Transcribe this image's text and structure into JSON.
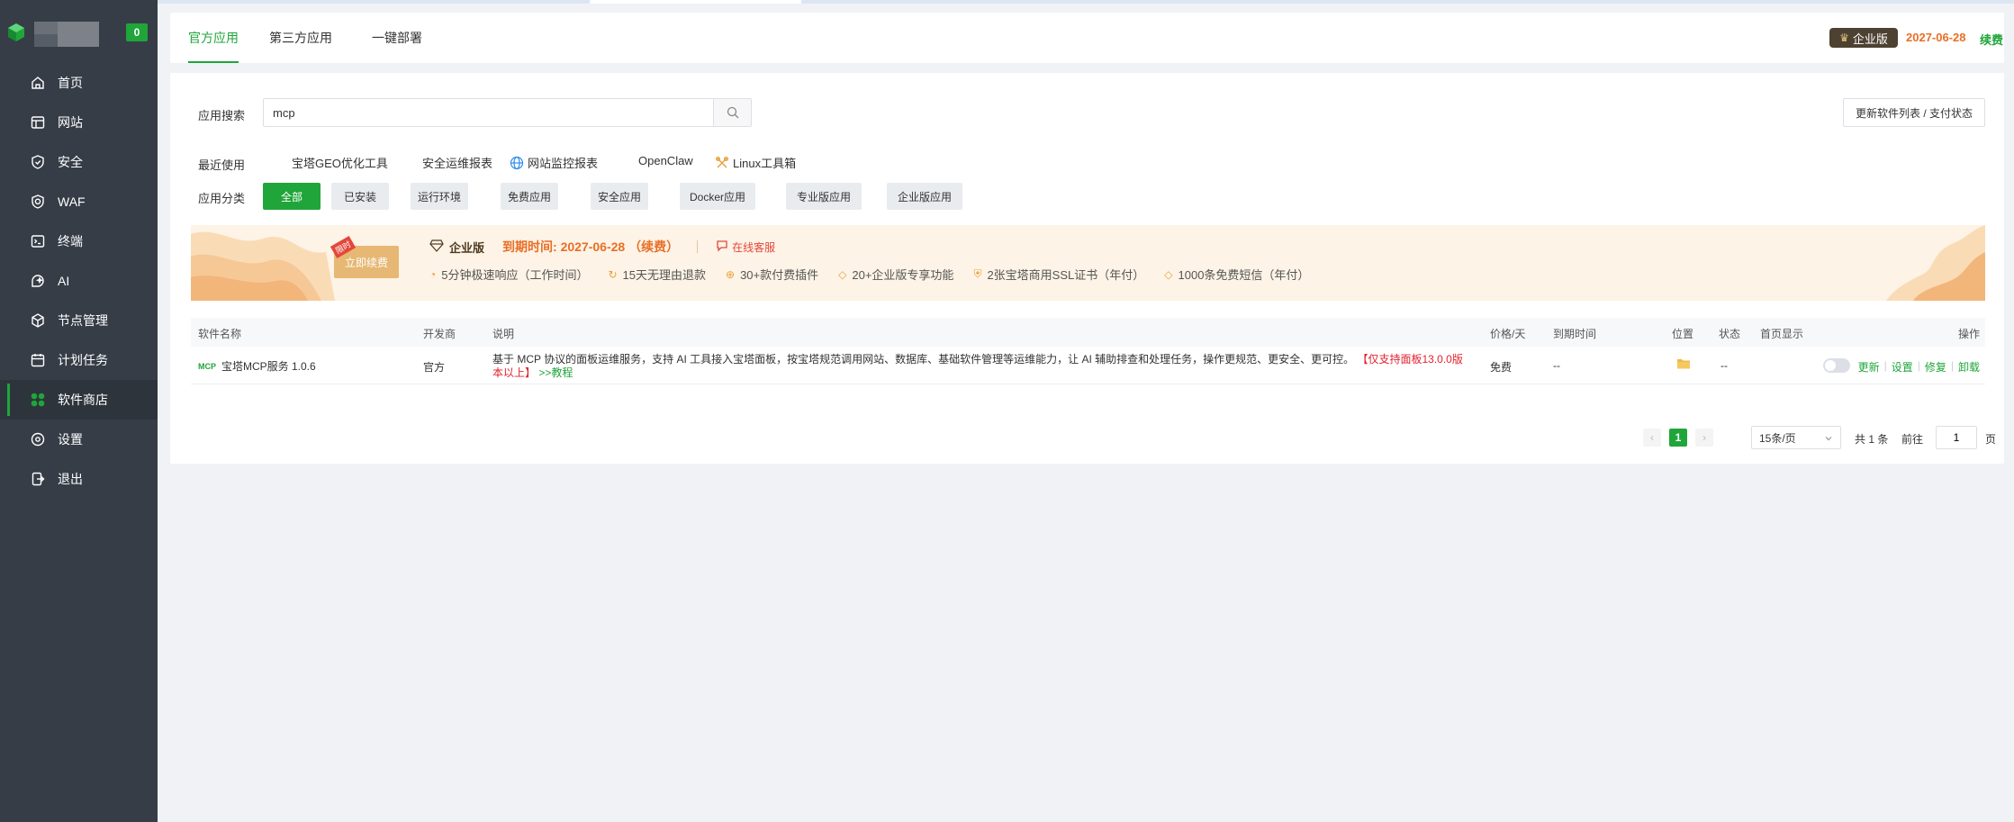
{
  "app": {
    "notification_count": "0"
  },
  "sidebar": {
    "items": [
      {
        "label": "首页",
        "icon": "home-icon"
      },
      {
        "label": "网站",
        "icon": "website-icon"
      },
      {
        "label": "安全",
        "icon": "shield-icon"
      },
      {
        "label": "WAF",
        "icon": "waf-icon"
      },
      {
        "label": "终端",
        "icon": "terminal-icon"
      },
      {
        "label": "AI",
        "icon": "ai-icon"
      },
      {
        "label": "节点管理",
        "icon": "node-icon"
      },
      {
        "label": "计划任务",
        "icon": "calendar-icon"
      },
      {
        "label": "软件商店",
        "icon": "store-icon"
      },
      {
        "label": "设置",
        "icon": "gear-icon"
      },
      {
        "label": "退出",
        "icon": "logout-icon"
      }
    ],
    "active_index": 8
  },
  "header": {
    "tabs": [
      "官方应用",
      "第三方应用",
      "一键部署"
    ],
    "active_tab": 0,
    "edition_label": "企业版",
    "expire_date": "2027-06-28",
    "renew_label": "续费"
  },
  "search": {
    "label": "应用搜索",
    "value": "mcp",
    "update_button": "更新软件列表 / 支付状态"
  },
  "recent": {
    "label": "最近使用",
    "items": [
      "宝塔GEO优化工具",
      "安全运维报表",
      "网站监控报表",
      "OpenClaw",
      "Linux工具箱"
    ]
  },
  "categories": {
    "label": "应用分类",
    "items": [
      "全部",
      "已安装",
      "运行环境",
      "免费应用",
      "安全应用",
      "Docker应用",
      "专业版应用",
      "企业版应用"
    ],
    "active_index": 0
  },
  "banner": {
    "ribbon_tag": "限时",
    "ribbon_label": "立即续费",
    "edition": "企业版",
    "expire_text": "到期时间: 2027-06-28 （续费）",
    "service_link": "在线客服",
    "features": [
      "5分钟极速响应（工作时间）",
      "15天无理由退款",
      "30+款付费插件",
      "20+企业版专享功能",
      "2张宝塔商用SSL证书（年付）",
      "1000条免费短信（年付）"
    ]
  },
  "table": {
    "headers": {
      "name": "软件名称",
      "developer": "开发商",
      "description": "说明",
      "price": "价格/天",
      "expire": "到期时间",
      "location": "位置",
      "status": "状态",
      "homepage": "首页显示",
      "actions": "操作"
    },
    "rows": [
      {
        "icon_text": "MCP",
        "name": "宝塔MCP服务 1.0.6",
        "developer": "官方",
        "description": "基于 MCP 协议的面板运维服务，支持 AI 工具接入宝塔面板，按宝塔规范调用网站、数据库、基础软件管理等运维能力，让 AI 辅助排查和处理任务，操作更规范、更安全、更可控。",
        "warning": "【仅支持面板13.0.0版本以上】",
        "tutorial": ">>教程",
        "price": "免费",
        "expire": "--",
        "status": "--",
        "actions": [
          "更新",
          "设置",
          "修复",
          "卸载"
        ]
      }
    ]
  },
  "pagination": {
    "current_page": "1",
    "per_page": "15条/页",
    "total_text": "共 1 条",
    "goto_label": "前往",
    "goto_value": "1",
    "page_suffix": "页"
  },
  "colors": {
    "accent": "#20a53a",
    "sidebar_bg": "#363d47",
    "warning": "#e3222e",
    "orange": "#e86f26"
  }
}
